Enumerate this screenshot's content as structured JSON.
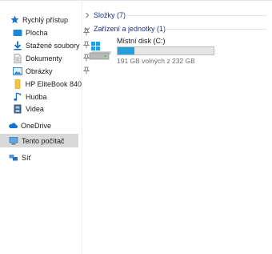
{
  "sidebar": {
    "quick_access": "Rychlý přístup",
    "items": [
      {
        "label": "Plocha",
        "icon": "desktop-icon",
        "pinned": true
      },
      {
        "label": "Stažené soubory",
        "icon": "downloads-icon",
        "pinned": true
      },
      {
        "label": "Dokumenty",
        "icon": "documents-icon",
        "pinned": true
      },
      {
        "label": "Obrázky",
        "icon": "pictures-icon",
        "pinned": true
      },
      {
        "label": "HP EliteBook 840",
        "icon": "folder-icon",
        "pinned": false
      },
      {
        "label": "Hudba",
        "icon": "music-icon",
        "pinned": false
      },
      {
        "label": "Videa",
        "icon": "videos-icon",
        "pinned": false
      }
    ],
    "onedrive": "OneDrive",
    "this_pc": "Tento počítač",
    "network": "Síť"
  },
  "main": {
    "folders_header": "Složky (7)",
    "devices_header": "Zařízení a jednotky (1)",
    "drive": {
      "name": "Místní disk (C:)",
      "free_text": "191 GB volných z 232 GB",
      "used_fraction": 0.177
    }
  },
  "colors": {
    "accent": "#26a0da",
    "header_text": "#1e3287",
    "selected_bg": "#d9d9d9"
  }
}
